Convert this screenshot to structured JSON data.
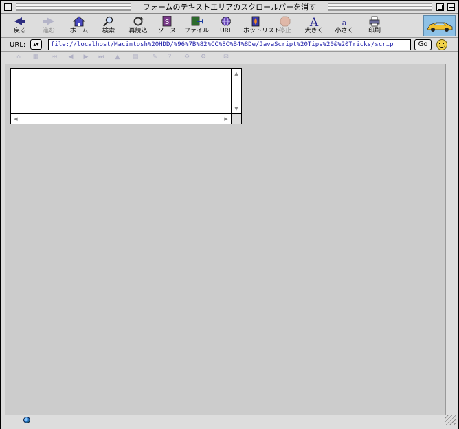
{
  "window": {
    "title": "フォームのテキストエリアのスクロールバーを消す"
  },
  "toolbar": {
    "buttons": [
      {
        "label": "戻る",
        "icon": "back-arrow-icon",
        "disabled": false
      },
      {
        "label": "進む",
        "icon": "forward-arrow-icon",
        "disabled": true
      },
      {
        "label": "ホーム",
        "icon": "home-icon",
        "disabled": false
      },
      {
        "label": "検索",
        "icon": "search-magnifier-icon",
        "disabled": false
      },
      {
        "label": "再読込",
        "icon": "reload-icon",
        "disabled": false
      },
      {
        "label": "ソース",
        "icon": "source-icon",
        "disabled": false
      },
      {
        "label": "ファイル",
        "icon": "file-icon",
        "disabled": false
      },
      {
        "label": "URL",
        "icon": "url-globe-icon",
        "disabled": false
      },
      {
        "label": "ホットリスト",
        "icon": "hotlist-icon",
        "disabled": false
      },
      {
        "label": "停止",
        "icon": "stop-icon",
        "disabled": true
      },
      {
        "label": "大きく",
        "icon": "text-larger-icon",
        "disabled": false
      },
      {
        "label": "小さく",
        "icon": "text-smaller-icon",
        "disabled": false
      },
      {
        "label": "印刷",
        "icon": "print-icon",
        "disabled": false
      }
    ],
    "logo_icon": "car-logo-icon"
  },
  "urlbar": {
    "label": "URL:",
    "value": "file://localhost/Macintosh%20HDD/%96%7B%82%CC%8C%B4%8De/JavaScript%20Tips%20&%20Tricks/scrip",
    "go_label": "Go",
    "status_icon": "smiley-face-icon"
  },
  "colors": {
    "chrome": "#dddddd",
    "content_bg": "#cccccc",
    "url_text": "#1a1aa8",
    "logo_bg": "#8ec1e6"
  },
  "page": {
    "textarea_value": ""
  }
}
